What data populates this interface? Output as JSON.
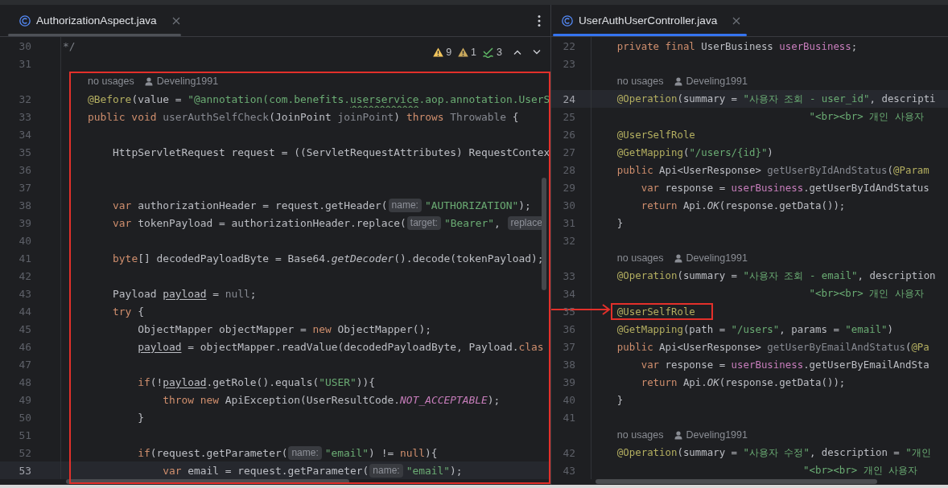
{
  "callout_arrow": true,
  "panes": [
    {
      "tab": {
        "title": "AuthorizationAspect.java",
        "selected": true
      },
      "focused": false,
      "framed": true,
      "more_menu": true,
      "inspections": [
        {
          "kind": "warning",
          "count": "9"
        },
        {
          "kind": "weak-warning",
          "count": "1"
        },
        {
          "kind": "typo",
          "count": "3"
        }
      ],
      "lines": [
        {
          "kind": "code",
          "number": "30",
          "current": false,
          "tokens": [
            {
              "kind": "comment",
              "text": "*/"
            }
          ]
        },
        {
          "kind": "code",
          "number": "31",
          "current": false
        },
        {
          "kind": "lens",
          "usages": "    no usages",
          "author": "Develing1991"
        },
        {
          "kind": "code",
          "number": "32",
          "current": false,
          "tokens": [
            {
              "kind": "annotation",
              "text": "    @Before"
            },
            {
              "kind": "plain",
              "text": "(value = "
            },
            {
              "kind": "string",
              "text": "\"@annotation(com.benefits."
            },
            {
              "kind": "typo",
              "text": "userservice"
            },
            {
              "kind": "string",
              "text": ".aop.annotation.UserS"
            }
          ]
        },
        {
          "kind": "code",
          "number": "33",
          "current": false,
          "tokens": [
            {
              "kind": "keyword",
              "text": "    public void "
            },
            {
              "kind": "unused",
              "text": "userAuthSelfCheck"
            },
            {
              "kind": "plain",
              "text": "(JoinPoint "
            },
            {
              "kind": "unused",
              "text": "joinPoint"
            },
            {
              "kind": "plain",
              "text": ") "
            },
            {
              "kind": "keyword",
              "text": "throws "
            },
            {
              "kind": "unused",
              "text": "Throwable"
            },
            {
              "kind": "plain",
              "text": " {"
            }
          ]
        },
        {
          "kind": "code",
          "number": "34",
          "current": false
        },
        {
          "kind": "code",
          "number": "35",
          "current": false,
          "tokens": [
            {
              "kind": "plain",
              "text": "        HttpServletRequest request = ((ServletRequestAttributes) RequestContex"
            }
          ]
        },
        {
          "kind": "code",
          "number": "36",
          "current": false
        },
        {
          "kind": "code",
          "number": "37",
          "current": false
        },
        {
          "kind": "code",
          "number": "38",
          "current": false,
          "tokens": [
            {
              "kind": "keyword",
              "text": "        var "
            },
            {
              "kind": "plain",
              "text": "authorizationHeader = request.getHeader("
            },
            {
              "kind": "hint",
              "text": "name:"
            },
            {
              "kind": "string",
              "text": "\"AUTHORIZATION\""
            },
            {
              "kind": "plain",
              "text": ");"
            }
          ]
        },
        {
          "kind": "code",
          "number": "39",
          "current": false,
          "tokens": [
            {
              "kind": "keyword",
              "text": "        var "
            },
            {
              "kind": "plain",
              "text": "tokenPayload = authorizationHeader.replace("
            },
            {
              "kind": "hint",
              "text": "target:"
            },
            {
              "kind": "string",
              "text": "\"Bearer\""
            },
            {
              "kind": "plain",
              "text": ", "
            },
            {
              "kind": "hint",
              "text": "replace"
            }
          ]
        },
        {
          "kind": "code",
          "number": "40",
          "current": false
        },
        {
          "kind": "code",
          "number": "41",
          "current": false,
          "tokens": [
            {
              "kind": "keyword",
              "text": "        byte"
            },
            {
              "kind": "plain",
              "text": "[] decodedPayloadByte = Base64."
            },
            {
              "kind": "italic",
              "text": "getDecoder"
            },
            {
              "kind": "plain",
              "text": "().decode(tokenPayload);"
            }
          ]
        },
        {
          "kind": "code",
          "number": "42",
          "current": false
        },
        {
          "kind": "code",
          "number": "43",
          "current": false,
          "tokens": [
            {
              "kind": "plain",
              "text": "        Payload "
            },
            {
              "kind": "underline",
              "text": "payload"
            },
            {
              "kind": "plain",
              "text": " = "
            },
            {
              "kind": "unused",
              "text": "null"
            },
            {
              "kind": "plain",
              "text": ";"
            }
          ]
        },
        {
          "kind": "code",
          "number": "44",
          "current": false,
          "tokens": [
            {
              "kind": "keyword",
              "text": "        try"
            },
            {
              "kind": "plain",
              "text": " {"
            }
          ]
        },
        {
          "kind": "code",
          "number": "45",
          "current": false,
          "tokens": [
            {
              "kind": "plain",
              "text": "            ObjectMapper objectMapper = "
            },
            {
              "kind": "keyword",
              "text": "new"
            },
            {
              "kind": "plain",
              "text": " ObjectMapper();"
            }
          ]
        },
        {
          "kind": "code",
          "number": "46",
          "current": false,
          "tokens": [
            {
              "kind": "underline",
              "text": "            payload"
            },
            {
              "kind": "plain",
              "text": " = objectMapper.readValue(decodedPayloadByte, Payload."
            },
            {
              "kind": "keyword",
              "text": "clas"
            }
          ]
        },
        {
          "kind": "code",
          "number": "47",
          "current": false
        },
        {
          "kind": "code",
          "number": "48",
          "current": false,
          "tokens": [
            {
              "kind": "keyword",
              "text": "            if"
            },
            {
              "kind": "plain",
              "text": "(!"
            },
            {
              "kind": "underline",
              "text": "payload"
            },
            {
              "kind": "plain",
              "text": ".getRole().equals("
            },
            {
              "kind": "string",
              "text": "\"USER\""
            },
            {
              "kind": "plain",
              "text": ")){"
            }
          ]
        },
        {
          "kind": "code",
          "number": "49",
          "current": false,
          "tokens": [
            {
              "kind": "keyword",
              "text": "                throw new "
            },
            {
              "kind": "plain",
              "text": "ApiException(UserResultCode."
            },
            {
              "kind": "constant",
              "text": "NOT_ACCEPTABLE"
            },
            {
              "kind": "plain",
              "text": ");"
            }
          ]
        },
        {
          "kind": "code",
          "number": "50",
          "current": false,
          "tokens": [
            {
              "kind": "plain",
              "text": "            }"
            }
          ]
        },
        {
          "kind": "code",
          "number": "51",
          "current": false
        },
        {
          "kind": "code",
          "number": "52",
          "current": false,
          "tokens": [
            {
              "kind": "keyword",
              "text": "            if"
            },
            {
              "kind": "plain",
              "text": "(request.getParameter("
            },
            {
              "kind": "hint",
              "text": "name:"
            },
            {
              "kind": "string",
              "text": "\"email\""
            },
            {
              "kind": "plain",
              "text": ") != "
            },
            {
              "kind": "keyword",
              "text": "null"
            },
            {
              "kind": "plain",
              "text": "){"
            }
          ]
        },
        {
          "kind": "code",
          "number": "53",
          "current": true,
          "tokens": [
            {
              "kind": "keyword",
              "text": "                var "
            },
            {
              "kind": "plain",
              "text": "email = request.getParameter("
            },
            {
              "kind": "hint",
              "text": "name:"
            },
            {
              "kind": "string",
              "text": "\"email\""
            },
            {
              "kind": "plain",
              "text": ");"
            }
          ]
        }
      ]
    },
    {
      "tab": {
        "title": "UserAuthUserController.java",
        "selected": true
      },
      "focused": true,
      "lines": [
        {
          "kind": "code",
          "number": "22",
          "current": false,
          "tokens": [
            {
              "kind": "keyword",
              "text": "    private final "
            },
            {
              "kind": "plain",
              "text": "UserBusiness "
            },
            {
              "kind": "field",
              "text": "userBusiness"
            },
            {
              "kind": "plain",
              "text": ";"
            }
          ]
        },
        {
          "kind": "code",
          "number": "23",
          "current": false
        },
        {
          "kind": "lens",
          "usages": "    no usages",
          "author": "Develing1991"
        },
        {
          "kind": "code",
          "number": "24",
          "current": true,
          "tokens": [
            {
              "kind": "annotation",
              "text": "    @Operation"
            },
            {
              "kind": "plain",
              "text": "(summary = "
            },
            {
              "kind": "string",
              "text": "\"사용자 조회 - user_id\""
            },
            {
              "kind": "plain",
              "text": ", descripti"
            }
          ]
        },
        {
          "kind": "code",
          "number": "25",
          "current": false,
          "tokens": [
            {
              "kind": "string",
              "text": "                                    \"<br><br> 개인 사용자"
            }
          ]
        },
        {
          "kind": "code",
          "number": "26",
          "current": false,
          "tokens": [
            {
              "kind": "annotation",
              "text": "    @UserSelfRole"
            }
          ]
        },
        {
          "kind": "code",
          "number": "27",
          "current": false,
          "tokens": [
            {
              "kind": "annotation",
              "text": "    @GetMapping"
            },
            {
              "kind": "plain",
              "text": "("
            },
            {
              "kind": "string",
              "text": "\"/users/{id}\""
            },
            {
              "kind": "plain",
              "text": ")"
            }
          ]
        },
        {
          "kind": "code",
          "number": "28",
          "current": false,
          "tokens": [
            {
              "kind": "keyword",
              "text": "    public "
            },
            {
              "kind": "plain",
              "text": "Api<UserResponse> "
            },
            {
              "kind": "unused",
              "text": "getUserByIdAndStatus"
            },
            {
              "kind": "plain",
              "text": "("
            },
            {
              "kind": "annotation",
              "text": "@Param"
            }
          ]
        },
        {
          "kind": "code",
          "number": "29",
          "current": false,
          "tokens": [
            {
              "kind": "keyword",
              "text": "        var "
            },
            {
              "kind": "plain",
              "text": "response = "
            },
            {
              "kind": "field",
              "text": "userBusiness"
            },
            {
              "kind": "plain",
              "text": ".getUserByIdAndStatus"
            }
          ]
        },
        {
          "kind": "code",
          "number": "30",
          "current": false,
          "tokens": [
            {
              "kind": "keyword",
              "text": "        return "
            },
            {
              "kind": "plain",
              "text": "Api."
            },
            {
              "kind": "italic",
              "text": "OK"
            },
            {
              "kind": "plain",
              "text": "(response.getData());"
            }
          ]
        },
        {
          "kind": "code",
          "number": "31",
          "current": false,
          "tokens": [
            {
              "kind": "plain",
              "text": "    }"
            }
          ]
        },
        {
          "kind": "code",
          "number": "32",
          "current": false
        },
        {
          "kind": "lens",
          "usages": "    no usages",
          "author": "Develing1991"
        },
        {
          "kind": "code",
          "number": "33",
          "current": false,
          "tokens": [
            {
              "kind": "annotation",
              "text": "    @Operation"
            },
            {
              "kind": "plain",
              "text": "(summary = "
            },
            {
              "kind": "string",
              "text": "\"사용자 조회 - email\""
            },
            {
              "kind": "plain",
              "text": ", description"
            }
          ]
        },
        {
          "kind": "code",
          "number": "34",
          "current": false,
          "tokens": [
            {
              "kind": "string",
              "text": "                                    \"<br><br> 개인 사용자"
            }
          ]
        },
        {
          "kind": "code",
          "number": "35",
          "current": false,
          "tokens": [
            {
              "kind": "marked",
              "text": "    @UserSelfRole"
            }
          ]
        },
        {
          "kind": "code",
          "number": "36",
          "current": false,
          "tokens": [
            {
              "kind": "annotation",
              "text": "    @GetMapping"
            },
            {
              "kind": "plain",
              "text": "(path = "
            },
            {
              "kind": "string",
              "text": "\"/users\""
            },
            {
              "kind": "plain",
              "text": ", params = "
            },
            {
              "kind": "string",
              "text": "\"email\""
            },
            {
              "kind": "plain",
              "text": ")"
            }
          ]
        },
        {
          "kind": "code",
          "number": "37",
          "current": false,
          "tokens": [
            {
              "kind": "keyword",
              "text": "    public "
            },
            {
              "kind": "plain",
              "text": "Api<UserResponse> "
            },
            {
              "kind": "unused",
              "text": "getUserByEmailAndStatus"
            },
            {
              "kind": "plain",
              "text": "("
            },
            {
              "kind": "annotation",
              "text": "@Pa"
            }
          ]
        },
        {
          "kind": "code",
          "number": "38",
          "current": false,
          "tokens": [
            {
              "kind": "keyword",
              "text": "        var "
            },
            {
              "kind": "plain",
              "text": "response = "
            },
            {
              "kind": "field",
              "text": "userBusiness"
            },
            {
              "kind": "plain",
              "text": ".getUserByEmailAndSta"
            }
          ]
        },
        {
          "kind": "code",
          "number": "39",
          "current": false,
          "tokens": [
            {
              "kind": "keyword",
              "text": "        return "
            },
            {
              "kind": "plain",
              "text": "Api."
            },
            {
              "kind": "italic",
              "text": "OK"
            },
            {
              "kind": "plain",
              "text": "(response.getData());"
            }
          ]
        },
        {
          "kind": "code",
          "number": "40",
          "current": false,
          "tokens": [
            {
              "kind": "plain",
              "text": "    }"
            }
          ]
        },
        {
          "kind": "code",
          "number": "41",
          "current": false
        },
        {
          "kind": "lens",
          "usages": "    no usages",
          "author": "Develing1991"
        },
        {
          "kind": "code",
          "number": "42",
          "current": false,
          "tokens": [
            {
              "kind": "annotation",
              "text": "    @Operation"
            },
            {
              "kind": "plain",
              "text": "(summary = "
            },
            {
              "kind": "string",
              "text": "\"사용자 수정\""
            },
            {
              "kind": "plain",
              "text": ", description = "
            },
            {
              "kind": "string",
              "text": "\"개인"
            }
          ]
        },
        {
          "kind": "code",
          "number": "43",
          "current": false,
          "tokens": [
            {
              "kind": "string",
              "text": "                                   \"<br><br> 개인 사용자"
            }
          ]
        }
      ]
    }
  ]
}
